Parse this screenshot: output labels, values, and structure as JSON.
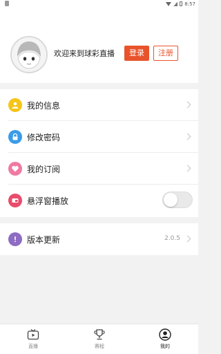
{
  "status_bar": {
    "time": "8:57"
  },
  "header": {
    "welcome_text": "欢迎来到球彩直播",
    "login_label": "登录",
    "register_label": "注册"
  },
  "menu": [
    {
      "label": "我的信息",
      "icon": "user-icon",
      "color": "#f5c518",
      "control": "chevron"
    },
    {
      "label": "修改密码",
      "icon": "lock-icon",
      "color": "#3b9be8",
      "control": "chevron"
    },
    {
      "label": "我的订阅",
      "icon": "heart-icon",
      "color": "#f07aa0",
      "control": "chevron"
    },
    {
      "label": "悬浮窗播放",
      "icon": "picture-in-picture-icon",
      "color": "#ea4c6c",
      "control": "toggle",
      "enabled": false
    }
  ],
  "version_row": {
    "label": "版本更新",
    "icon": "info-icon",
    "color": "#8e6cc4",
    "value": "2.0.5"
  },
  "tabs": [
    {
      "label": "直播",
      "icon": "tv-icon",
      "active": false
    },
    {
      "label": "赛程",
      "icon": "trophy-icon",
      "active": false
    },
    {
      "label": "我的",
      "icon": "profile-icon",
      "active": true
    }
  ],
  "colors": {
    "accent": "#e8532b",
    "background": "#f2f2f2"
  }
}
